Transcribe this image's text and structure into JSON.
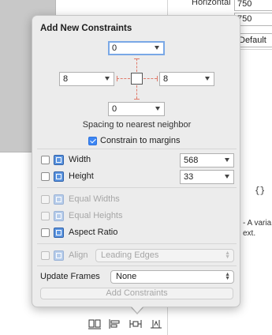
{
  "inspector": {
    "horizontal_label": "Horizontal",
    "horizontal_value": "750",
    "second_value": "750",
    "select_value": "Default",
    "braces": "{}",
    "description_line1": "- A varia",
    "description_line2": "ext."
  },
  "popover": {
    "title": "Add New Constraints",
    "spacing": {
      "top": "0",
      "left": "8",
      "right": "8",
      "bottom": "0",
      "caption": "Spacing to nearest neighbor"
    },
    "constrain_to_margins": {
      "label": "Constrain to margins",
      "checked": true
    },
    "width": {
      "label": "Width",
      "value": "568",
      "checked": false
    },
    "height": {
      "label": "Height",
      "value": "33",
      "checked": false
    },
    "equal_widths": {
      "label": "Equal Widths",
      "enabled": false
    },
    "equal_heights": {
      "label": "Equal Heights",
      "enabled": false
    },
    "aspect_ratio": {
      "label": "Aspect Ratio",
      "checked": false
    },
    "align": {
      "label": "Align",
      "value": "Leading Edges",
      "enabled": false
    },
    "update_frames": {
      "label": "Update Frames",
      "value": "None"
    },
    "add_button": "Add Constraints"
  },
  "toolbar": {
    "icons": [
      "stack-icon",
      "align-icon",
      "pin-icon",
      "resolve-issues-icon"
    ]
  },
  "colors": {
    "accent": "#3d86f4",
    "focus_ring": "#7aa8e6",
    "guide_red": "#e07a6a",
    "popover_bg": "#ececec"
  }
}
